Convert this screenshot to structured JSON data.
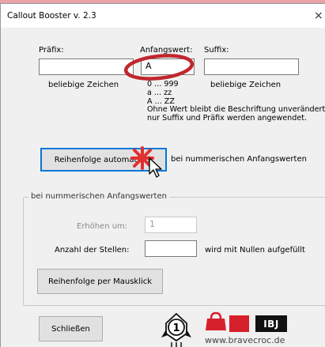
{
  "window": {
    "title": "Callout Booster v. 2.3",
    "close_glyph": "×"
  },
  "fields": {
    "prefix_label": "Präfix:",
    "start_label": "Anfangswert:",
    "suffix_label": "Suffix:",
    "prefix_value": "",
    "start_value": "A",
    "suffix_value": "",
    "prefix_hint": "beliebige Zeichen",
    "suffix_hint": "beliebige Zeichen"
  },
  "start_hints": [
    "0 ... 999",
    "a ... zz",
    "A ... ZZ",
    "Ohne Wert bleibt die Beschriftung unverändert,",
    "nur Suffix und Präfix werden angewendet."
  ],
  "auto_button": {
    "label": "Reihenfolge automatisch",
    "side_text": "bei nummerischen Anfangswerten"
  },
  "numeric_group": {
    "legend": "bei nummerischen Anfangswerten",
    "increment_label": "Erhöhen um:",
    "increment_value": "1",
    "digits_label": "Anzahl der Stellen:",
    "digits_value": "",
    "digits_hint": "wird mit Nullen aufgefüllt",
    "click_button_label": "Reihenfolge per Mausklick"
  },
  "footer": {
    "close_button_label": "Schließen",
    "logo_text": "IBJ",
    "website": "www.bravecroc.de",
    "badge_number": "1"
  },
  "colors": {
    "annotation_red": "#c0272d",
    "accent_blue": "#0078d7",
    "logo_red": "#d6202b"
  },
  "icons": [
    "close-icon",
    "mouse-cursor-icon",
    "click-burst-icon",
    "rocket-badge-icon",
    "shopping-bag-icon",
    "ibj-logo-icon"
  ]
}
